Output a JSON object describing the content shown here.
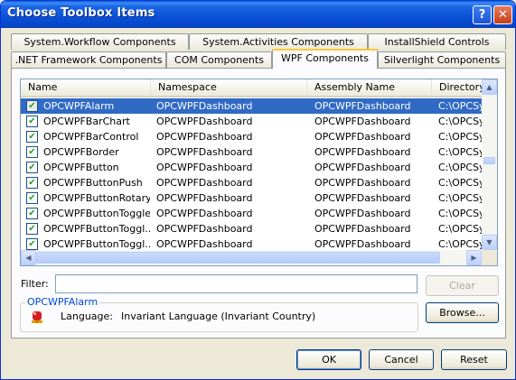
{
  "window": {
    "title": "Choose Toolbox Items",
    "help_glyph": "?",
    "close_glyph": "✕"
  },
  "tabs": {
    "row_back": [
      "System.Workflow Components",
      "System.Activities Components",
      "InstallShield Controls"
    ],
    "row_front": [
      ".NET Framework Components",
      "COM Components",
      "WPF Components",
      "Silverlight Components"
    ],
    "active": "WPF Components"
  },
  "table": {
    "columns": [
      "Name",
      "Namespace",
      "Assembly Name",
      "Directory"
    ],
    "rows": [
      {
        "name": "OPCWPFAlarm",
        "namespace": "OPCWPFDashboard",
        "assembly": "OPCWPFDashboard",
        "directory": "C:\\OPCSy",
        "checked": true,
        "selected": true
      },
      {
        "name": "OPCWPFBarChart",
        "namespace": "OPCWPFDashboard",
        "assembly": "OPCWPFDashboard",
        "directory": "C:\\OPCSy",
        "checked": true,
        "selected": false
      },
      {
        "name": "OPCWPFBarControl",
        "namespace": "OPCWPFDashboard",
        "assembly": "OPCWPFDashboard",
        "directory": "C:\\OPCSy",
        "checked": true,
        "selected": false
      },
      {
        "name": "OPCWPFBorder",
        "namespace": "OPCWPFDashboard",
        "assembly": "OPCWPFDashboard",
        "directory": "C:\\OPCSy",
        "checked": true,
        "selected": false
      },
      {
        "name": "OPCWPFButton",
        "namespace": "OPCWPFDashboard",
        "assembly": "OPCWPFDashboard",
        "directory": "C:\\OPCSy",
        "checked": true,
        "selected": false
      },
      {
        "name": "OPCWPFButtonPush",
        "namespace": "OPCWPFDashboard",
        "assembly": "OPCWPFDashboard",
        "directory": "C:\\OPCSy",
        "checked": true,
        "selected": false
      },
      {
        "name": "OPCWPFButtonRotary",
        "namespace": "OPCWPFDashboard",
        "assembly": "OPCWPFDashboard",
        "directory": "C:\\OPCSy",
        "checked": true,
        "selected": false
      },
      {
        "name": "OPCWPFButtonToggle1",
        "namespace": "OPCWPFDashboard",
        "assembly": "OPCWPFDashboard",
        "directory": "C:\\OPCSy",
        "checked": true,
        "selected": false
      },
      {
        "name": "OPCWPFButtonToggl...",
        "namespace": "OPCWPFDashboard",
        "assembly": "OPCWPFDashboard",
        "directory": "C:\\OPCSy",
        "checked": true,
        "selected": false
      },
      {
        "name": "OPCWPFButtonToggl...",
        "namespace": "OPCWPFDashboard",
        "assembly": "OPCWPFDashboard",
        "directory": "C:\\OPCSy",
        "checked": true,
        "selected": false
      }
    ]
  },
  "filter": {
    "label": "Filter:",
    "value": "",
    "clear_label": "Clear"
  },
  "details": {
    "title": "OPCWPFAlarm",
    "language_label": "Language:",
    "language_value": "Invariant Language (Invariant Country)",
    "browse_label": "Browse..."
  },
  "footer": {
    "ok_label": "OK",
    "cancel_label": "Cancel",
    "reset_label": "Reset"
  },
  "colors": {
    "selection": "#316ac5",
    "titlebar": "#0a52d6",
    "active_tab_accent": "#ffc83c",
    "check": "#21a121"
  }
}
